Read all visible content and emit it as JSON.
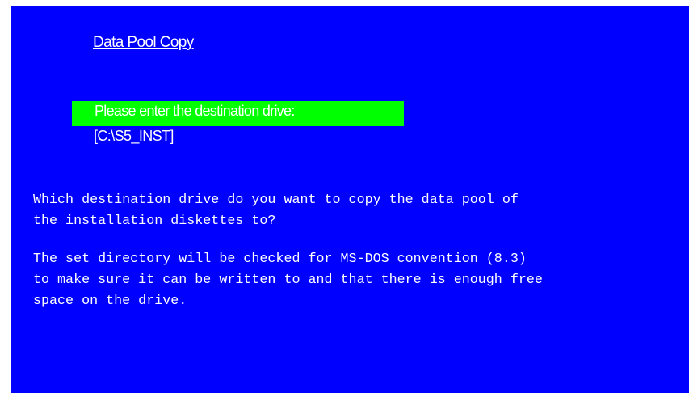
{
  "screen": {
    "title": "Data Pool Copy",
    "prompt_label": "Please enter the destination drive:",
    "drive_value": "[C:\\S5_INST]",
    "help_paragraph_1": [
      "Which destination drive do you want to copy the data pool of",
      "the installation diskettes to?"
    ],
    "help_paragraph_2": [
      "The set directory will be checked for MS-DOS convention (8.3)",
      "to make sure it can be written to and that there is enough free",
      "space on the drive."
    ]
  },
  "colors": {
    "background": "#0000ff",
    "highlight": "#00ff00",
    "text": "#ffffff"
  }
}
